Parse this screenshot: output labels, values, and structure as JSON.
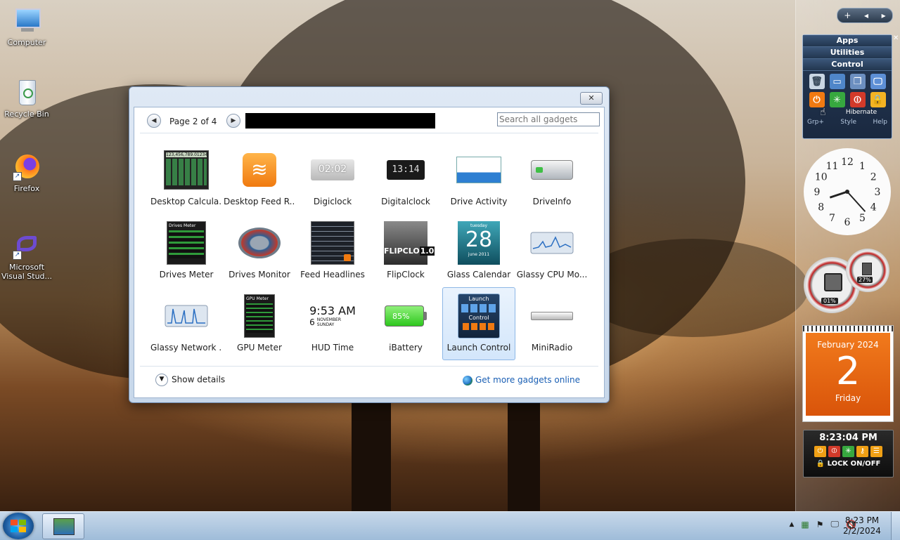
{
  "desktop": {
    "icons": [
      {
        "label": "Computer"
      },
      {
        "label": "Recycle Bin"
      },
      {
        "label": "Firefox"
      },
      {
        "label": "Microsoft Visual Stud..."
      }
    ]
  },
  "gallery": {
    "page_label": "Page 2 of 4",
    "search_placeholder": "Search all gadgets",
    "gadgets": [
      {
        "name": "Desktop Calcula..."
      },
      {
        "name": "Desktop Feed R..."
      },
      {
        "name": "Digiclock"
      },
      {
        "name": "Digitalclock"
      },
      {
        "name": "Drive Activity"
      },
      {
        "name": "DriveInfo"
      },
      {
        "name": "Drives Meter"
      },
      {
        "name": "Drives Monitor"
      },
      {
        "name": "Feed Headlines"
      },
      {
        "name": "FlipClock"
      },
      {
        "name": "Glass Calendar"
      },
      {
        "name": "Glassy CPU Mo..."
      },
      {
        "name": "Glassy Network ..."
      },
      {
        "name": "GPU Meter"
      },
      {
        "name": "HUD Time"
      },
      {
        "name": "iBattery"
      },
      {
        "name": "Launch Control"
      },
      {
        "name": "MiniRadio"
      }
    ],
    "selected": "Launch Control",
    "thumb_text": {
      "calc_display": "123,456,789.01234",
      "digiclock": "02:02",
      "digitalclock": "13:14",
      "drives_meter_title": "Drives Meter",
      "gpu_meter_title": "GPU Meter",
      "flip": "FLIPCLO",
      "flip_ver": "1.0",
      "glass_cal_day": "28",
      "glass_cal_top": "tuesday",
      "glass_cal_bottom": "june 2011",
      "hud_time": "9:53 AM",
      "hud_day": "6",
      "hud_month": "NOVEMBER",
      "hud_wd": "SUNDAY",
      "battery": "85%",
      "lc_launch": "Launch",
      "lc_control": "Control"
    },
    "show_details": "Show details",
    "get_more": "Get more gadgets online"
  },
  "launch_control": {
    "rows": [
      "Apps",
      "Utilities",
      "Control"
    ],
    "hover_label": "Hibernate",
    "footer": [
      "Grp+",
      "Style",
      "Help"
    ]
  },
  "analog_clock": {
    "numbers": [
      "12",
      "1",
      "2",
      "3",
      "4",
      "5",
      "6",
      "7",
      "8",
      "9",
      "10",
      "11"
    ],
    "hour": 8,
    "minute": 23
  },
  "meters": {
    "cpu": "01%",
    "ram": "27%"
  },
  "calendar": {
    "month": "February 2024",
    "day": "2",
    "weekday": "Friday"
  },
  "mini_clock": {
    "time": "8:23:04 PM",
    "lock_label": "LOCK ON/OFF"
  },
  "taskbar": {
    "time": "8:23 PM",
    "date": "2/2/2024"
  },
  "colors": {
    "accent": "#d9540a",
    "selection": "#d3e6fb",
    "link": "#1a5fb4"
  }
}
